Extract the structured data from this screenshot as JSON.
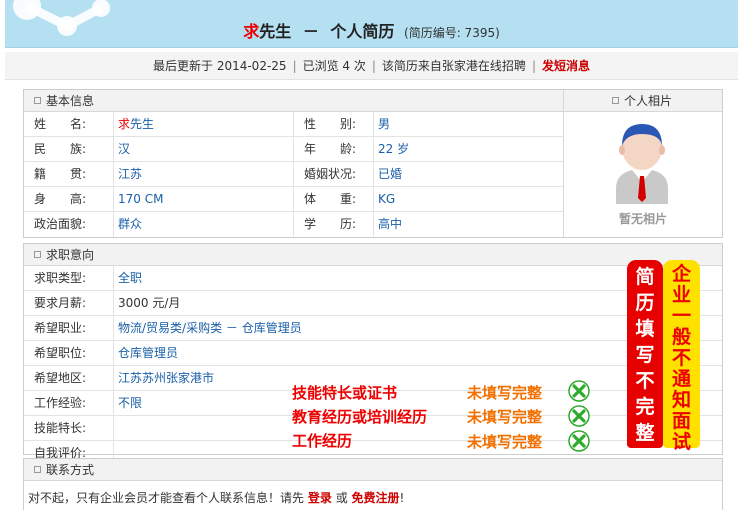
{
  "header": {
    "surname": "求",
    "name_rest": "先生",
    "dash": "－",
    "title": "个人简历",
    "resume_no": "(简历编号: 7395)"
  },
  "meta": {
    "updated": "最后更新于  2014-02-25",
    "views": "已浏览  4  次",
    "source": "该简历来自张家港在线招聘",
    "msg_link": "发短消息"
  },
  "basic": {
    "section_title": "基本信息",
    "photo_title": "个人相片",
    "no_photo": "暂无相片",
    "rows": [
      {
        "l1": "姓　　名:",
        "v1_red": "求",
        "v1": "先生",
        "l2": "性　　别:",
        "v2": "男"
      },
      {
        "l1": "民　　族:",
        "v1_red": "",
        "v1": "汉",
        "l2": "年　　龄:",
        "v2": "22 岁"
      },
      {
        "l1": "籍　　贯:",
        "v1_red": "",
        "v1": "江苏",
        "l2": "婚姻状况:",
        "v2": "已婚"
      },
      {
        "l1": "身　　高:",
        "v1_red": "",
        "v1": "170 CM",
        "l2": "体　　重:",
        "v2": "KG"
      },
      {
        "l1": "政治面貌:",
        "v1_red": "",
        "v1": "群众",
        "l2": "学　　历:",
        "v2": "高中"
      }
    ]
  },
  "intent": {
    "section_title": "求职意向",
    "rows": [
      {
        "label": "求职类型:",
        "value": "全职"
      },
      {
        "label": "要求月薪:",
        "value": "3000 元/月"
      },
      {
        "label": "希望职业:",
        "value": "物流/贸易类/采购类 － 仓库管理员"
      },
      {
        "label": "希望职位:",
        "value": "仓库管理员"
      },
      {
        "label": "希望地区:",
        "value": "江苏苏州张家港市"
      },
      {
        "label": "工作经验:",
        "value": "不限"
      },
      {
        "label": "技能特长:",
        "value": ""
      },
      {
        "label": "自我评价:",
        "value": ""
      }
    ]
  },
  "overlay": {
    "items": [
      {
        "text": "技能特长或证书",
        "status": "未填写完整"
      },
      {
        "text": "教育经历或培训经历",
        "status": "未填写完整"
      },
      {
        "text": "工作经历",
        "status": "未填写完整"
      }
    ],
    "banner_red": [
      "简",
      "历",
      "填",
      "写",
      "不",
      "完",
      "整"
    ],
    "banner_yellow": [
      "企",
      "业",
      "一",
      "般",
      "不",
      "通",
      "知",
      "面",
      "试"
    ]
  },
  "contact": {
    "section_title": "联系方式",
    "notice": "对不起，只有企业会员才能查看个人联系信息！请先",
    "login": "登录",
    "or": "或",
    "register": "免费注册",
    "end": "!"
  },
  "colors": {
    "header_bg": "#b4e0f2",
    "value_blue": "#1a5fa8",
    "accent_red": "#e00",
    "overlay_orange": "#f27000",
    "banner_yellow": "#ffe100",
    "x_green": "#2eaa2e"
  }
}
